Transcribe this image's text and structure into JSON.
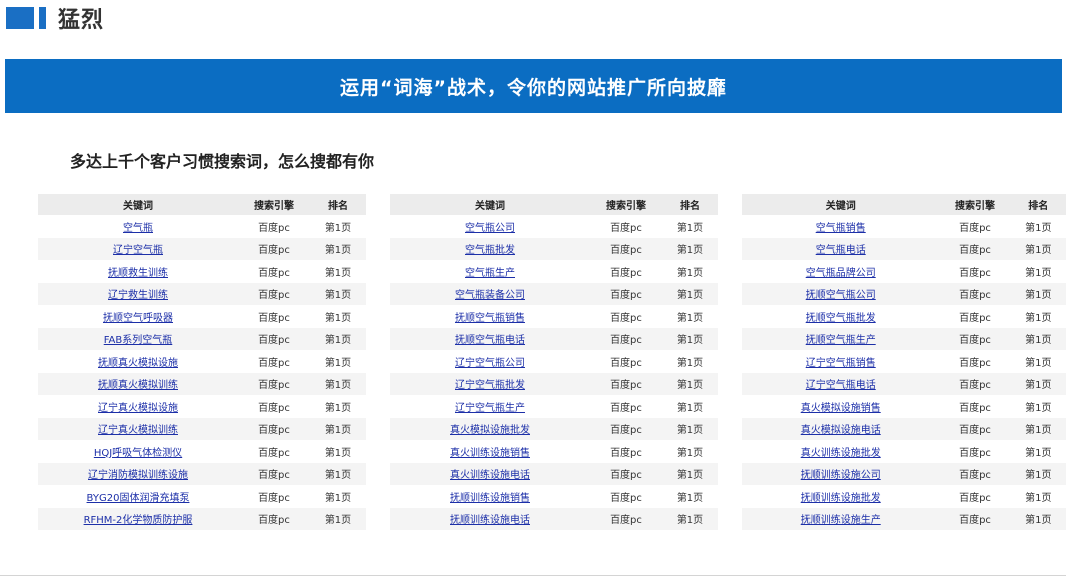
{
  "heading": {
    "title": "猛烈"
  },
  "banner": {
    "text": "运用“词海”战术，令你的网站推广所向披靡"
  },
  "subheading": "多达上千个客户习惯搜索词，怎么搜都有你",
  "colors": {
    "accent": "#0b6dc2",
    "link": "#1c2fa8",
    "header_row_bg": "#ececec"
  },
  "table_headers": {
    "keyword": "关键词",
    "search_engine": "搜索引擎",
    "rank": "排名"
  },
  "tables": [
    {
      "rows": [
        {
          "keyword": "空气瓶",
          "engine": "百度pc",
          "rank": "第1页"
        },
        {
          "keyword": "辽宁空气瓶",
          "engine": "百度pc",
          "rank": "第1页"
        },
        {
          "keyword": "抚顺救生训练",
          "engine": "百度pc",
          "rank": "第1页"
        },
        {
          "keyword": "辽宁救生训练",
          "engine": "百度pc",
          "rank": "第1页"
        },
        {
          "keyword": "抚顺空气呼吸器",
          "engine": "百度pc",
          "rank": "第1页"
        },
        {
          "keyword": "FAB系列空气瓶",
          "engine": "百度pc",
          "rank": "第1页"
        },
        {
          "keyword": "抚顺真火模拟设施",
          "engine": "百度pc",
          "rank": "第1页"
        },
        {
          "keyword": "抚顺真火模拟训练",
          "engine": "百度pc",
          "rank": "第1页"
        },
        {
          "keyword": "辽宁真火模拟设施",
          "engine": "百度pc",
          "rank": "第1页"
        },
        {
          "keyword": "辽宁真火模拟训练",
          "engine": "百度pc",
          "rank": "第1页"
        },
        {
          "keyword": "HQJ呼吸气体检测仪",
          "engine": "百度pc",
          "rank": "第1页"
        },
        {
          "keyword": "辽宁消防模拟训练设施",
          "engine": "百度pc",
          "rank": "第1页"
        },
        {
          "keyword": "BYG20固体润滑充填泵",
          "engine": "百度pc",
          "rank": "第1页"
        },
        {
          "keyword": "RFHM-2化学物质防护服",
          "engine": "百度pc",
          "rank": "第1页"
        }
      ]
    },
    {
      "rows": [
        {
          "keyword": "空气瓶公司",
          "engine": "百度pc",
          "rank": "第1页"
        },
        {
          "keyword": "空气瓶批发",
          "engine": "百度pc",
          "rank": "第1页"
        },
        {
          "keyword": "空气瓶生产",
          "engine": "百度pc",
          "rank": "第1页"
        },
        {
          "keyword": "空气瓶装备公司",
          "engine": "百度pc",
          "rank": "第1页"
        },
        {
          "keyword": "抚顺空气瓶销售",
          "engine": "百度pc",
          "rank": "第1页"
        },
        {
          "keyword": "抚顺空气瓶电话",
          "engine": "百度pc",
          "rank": "第1页"
        },
        {
          "keyword": "辽宁空气瓶公司",
          "engine": "百度pc",
          "rank": "第1页"
        },
        {
          "keyword": "辽宁空气瓶批发",
          "engine": "百度pc",
          "rank": "第1页"
        },
        {
          "keyword": "辽宁空气瓶生产",
          "engine": "百度pc",
          "rank": "第1页"
        },
        {
          "keyword": "真火模拟设施批发",
          "engine": "百度pc",
          "rank": "第1页"
        },
        {
          "keyword": "真火训练设施销售",
          "engine": "百度pc",
          "rank": "第1页"
        },
        {
          "keyword": "真火训练设施电话",
          "engine": "百度pc",
          "rank": "第1页"
        },
        {
          "keyword": "抚顺训练设施销售",
          "engine": "百度pc",
          "rank": "第1页"
        },
        {
          "keyword": "抚顺训练设施电话",
          "engine": "百度pc",
          "rank": "第1页"
        }
      ]
    },
    {
      "rows": [
        {
          "keyword": "空气瓶销售",
          "engine": "百度pc",
          "rank": "第1页"
        },
        {
          "keyword": "空气瓶电话",
          "engine": "百度pc",
          "rank": "第1页"
        },
        {
          "keyword": "空气瓶品牌公司",
          "engine": "百度pc",
          "rank": "第1页"
        },
        {
          "keyword": "抚顺空气瓶公司",
          "engine": "百度pc",
          "rank": "第1页"
        },
        {
          "keyword": "抚顺空气瓶批发",
          "engine": "百度pc",
          "rank": "第1页"
        },
        {
          "keyword": "抚顺空气瓶生产",
          "engine": "百度pc",
          "rank": "第1页"
        },
        {
          "keyword": "辽宁空气瓶销售",
          "engine": "百度pc",
          "rank": "第1页"
        },
        {
          "keyword": "辽宁空气瓶电话",
          "engine": "百度pc",
          "rank": "第1页"
        },
        {
          "keyword": "真火模拟设施销售",
          "engine": "百度pc",
          "rank": "第1页"
        },
        {
          "keyword": "真火模拟设施电话",
          "engine": "百度pc",
          "rank": "第1页"
        },
        {
          "keyword": "真火训练设施批发",
          "engine": "百度pc",
          "rank": "第1页"
        },
        {
          "keyword": "抚顺训练设施公司",
          "engine": "百度pc",
          "rank": "第1页"
        },
        {
          "keyword": "抚顺训练设施批发",
          "engine": "百度pc",
          "rank": "第1页"
        },
        {
          "keyword": "抚顺训练设施生产",
          "engine": "百度pc",
          "rank": "第1页"
        }
      ]
    }
  ]
}
